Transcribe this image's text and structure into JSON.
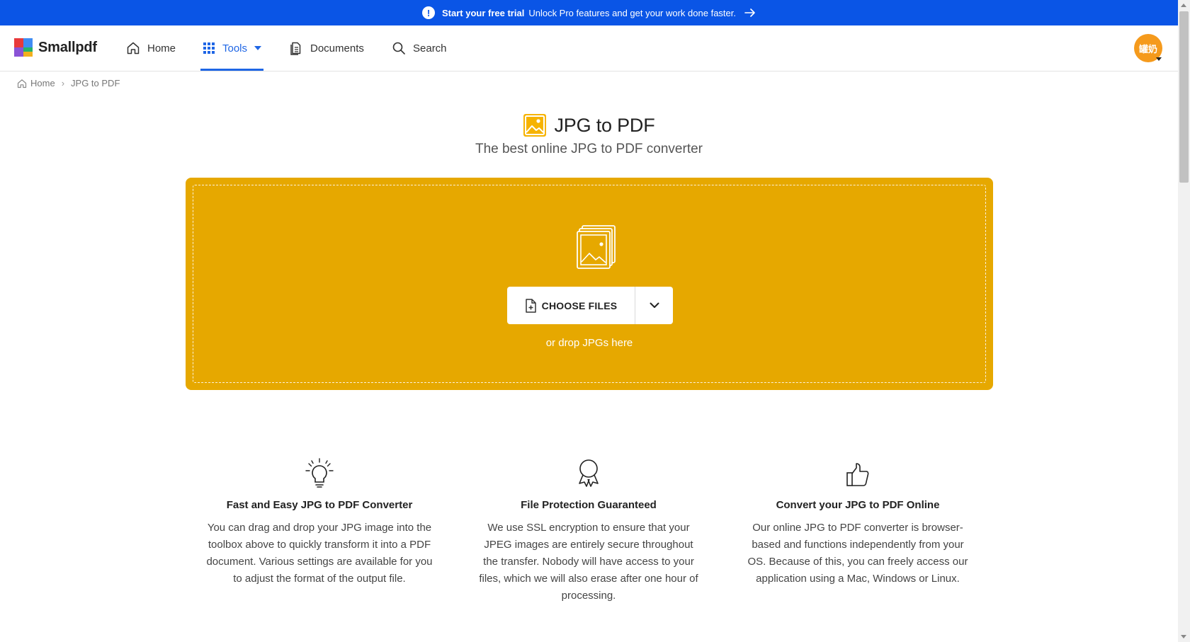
{
  "promo": {
    "strong": "Start your free trial",
    "text": "Unlock Pro features and get your work done faster.",
    "accent": "#0a55e6"
  },
  "header": {
    "brand": "Smallpdf",
    "nav": {
      "home": "Home",
      "tools": "Tools",
      "documents": "Documents",
      "search": "Search"
    },
    "avatar_text": "罐奶"
  },
  "breadcrumb": {
    "home": "Home",
    "current": "JPG to PDF"
  },
  "main": {
    "title": "JPG to PDF",
    "subtitle": "The best online JPG to PDF converter",
    "dropzone_color": "#e6a800",
    "choose_label": "CHOOSE FILES",
    "drop_hint": "or drop JPGs here"
  },
  "features": [
    {
      "icon": "lightbulb-icon",
      "title": "Fast and Easy JPG to PDF Converter",
      "text": "You can drag and drop your JPG image into the toolbox above to quickly transform it into a PDF document. Various settings are available for you to adjust the format of the output file."
    },
    {
      "icon": "award-ribbon-icon",
      "title": "File Protection Guaranteed",
      "text": "We use SSL encryption to ensure that your JPEG images are entirely secure throughout the transfer. Nobody will have access to your files, which we will also erase after one hour of processing."
    },
    {
      "icon": "thumbs-up-icon",
      "title": "Convert your JPG to PDF Online",
      "text": "Our online JPG to PDF converter is browser-based and functions independently from your OS. Because of this, you can freely access our application using a Mac, Windows or Linux."
    }
  ]
}
